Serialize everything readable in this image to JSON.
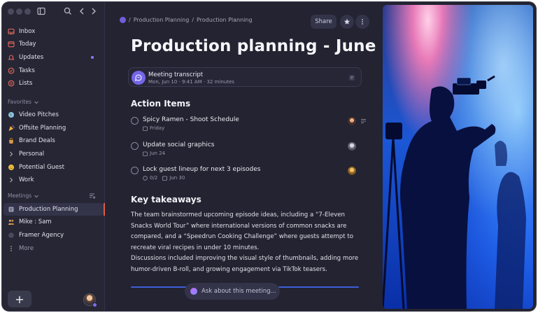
{
  "sidebar": {
    "nav": [
      {
        "label": "Inbox",
        "icon": "inbox-icon",
        "color": "#e86a5a"
      },
      {
        "label": "Today",
        "icon": "calendar-icon",
        "color": "#e86a5a"
      },
      {
        "label": "Updates",
        "icon": "bell-icon",
        "color": "#e86a5a"
      },
      {
        "label": "Tasks",
        "icon": "check-circle-icon",
        "color": "#e86a5a"
      },
      {
        "label": "Lists",
        "icon": "list-icon",
        "color": "#e86a5a"
      }
    ],
    "favorites_label": "Favorites",
    "favorites": [
      {
        "label": "Video Pitches",
        "icon": "globe-icon"
      },
      {
        "label": "Offsite Planning",
        "icon": "party-icon"
      },
      {
        "label": "Brand Deals",
        "icon": "bag-icon"
      },
      {
        "label": "Personal",
        "icon": "chevron-right-icon"
      },
      {
        "label": "Potential Guest",
        "icon": "face-icon"
      },
      {
        "label": "Work",
        "icon": "chevron-right-icon"
      }
    ],
    "meetings_label": "Meetings",
    "meetings": [
      {
        "label": "Production Planning",
        "icon": "document-icon"
      },
      {
        "label": "Mike : Sam",
        "icon": "people-icon"
      },
      {
        "label": "Framer Agency",
        "icon": "circle-icon"
      }
    ],
    "more_label": "More",
    "add_label": "+"
  },
  "main": {
    "breadcrumb": [
      "Production Planning",
      "Production Planning"
    ],
    "share_label": "Share",
    "title": "Production planning - June",
    "transcript": {
      "title": "Meeting transcript",
      "date": "Mon, Jun 10",
      "time": "9:41 AM",
      "duration": "32 minutes"
    },
    "action_items_heading": "Action Items",
    "tasks": [
      {
        "title": "Spicy Ramen - Shoot Schedule",
        "meta": "Friday",
        "subtasks": ""
      },
      {
        "title": "Update social graphics",
        "meta": "Jun 24",
        "subtasks": ""
      },
      {
        "title": "Lock guest lineup for next 3 episodes",
        "meta": "Jun 30",
        "subtasks": "0/2"
      }
    ],
    "key_takeaways_heading": "Key takeaways",
    "para1": "The team brainstormed upcoming episode ideas, including a “7-Eleven Snacks World Tour” where international versions of common snacks are compared, and a “Speedrun Cooking Challenge” where guests attempt to recreate viral recipes in under 10 minutes.",
    "para2": "Discussions included improving the visual style of thumbnails, adding more humor-driven B-roll, and growing engagement via TikTok teasers.",
    "ask_placeholder": "Ask about this meeting..."
  },
  "colors": {
    "accent": "#7466e6",
    "sidebar_icon": "#e86a5a",
    "active_bar": "#e05a47"
  }
}
